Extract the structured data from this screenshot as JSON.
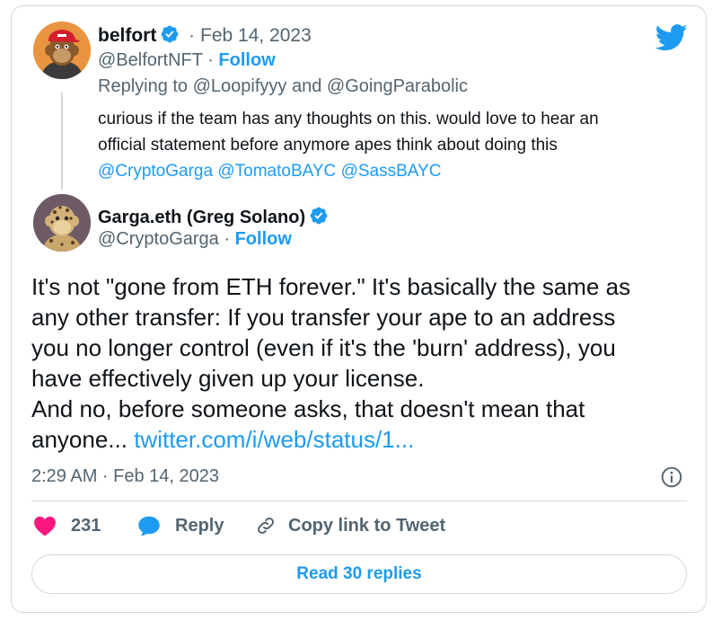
{
  "reply_tweet": {
    "display_name": "belfort",
    "date": "· Feb 14, 2023",
    "handle": "@BelfortNFT",
    "follow_label": "Follow",
    "replying_prefix": "Replying to ",
    "replying_user1": "@Loopifyyy",
    "replying_and": " and ",
    "replying_user2": "@GoingParabolic",
    "text_line1": "curious if the team has any thoughts on this. would love to hear an",
    "text_line2": "official statement before anymore apes think about doing this",
    "mention1": "@CryptoGarga",
    "mention2": "@TomatoBAYC",
    "mention3": "@SassBAYC"
  },
  "main_tweet": {
    "display_name": "Garga.eth (Greg Solano)",
    "handle": "@CryptoGarga",
    "follow_label": "Follow",
    "text_line1": "It's not \"gone from ETH forever.\" It's basically the same as",
    "text_line2": "any other transfer: If you transfer your ape to an address",
    "text_line3": "you no longer control (even if it's the 'burn' address), you",
    "text_line4": "have effectively given up your license.",
    "text_line5": "And no, before someone asks, that doesn't mean that",
    "text_line6_prefix": "anyone... ",
    "link_text": "twitter.com/i/web/status/1...",
    "timestamp": "2:29 AM · Feb 14, 2023"
  },
  "actions": {
    "like_count": "231",
    "reply_label": "Reply",
    "copy_link_label": "Copy link to Tweet"
  },
  "read_replies_label": "Read 30 replies",
  "colors": {
    "accent": "#1d9bf0",
    "like": "#f91880",
    "text": "#0f1419",
    "secondary": "#536471"
  },
  "icons": [
    "twitter-bird-icon",
    "verified-badge-icon",
    "info-icon",
    "heart-icon",
    "reply-bubble-icon",
    "link-icon"
  ]
}
